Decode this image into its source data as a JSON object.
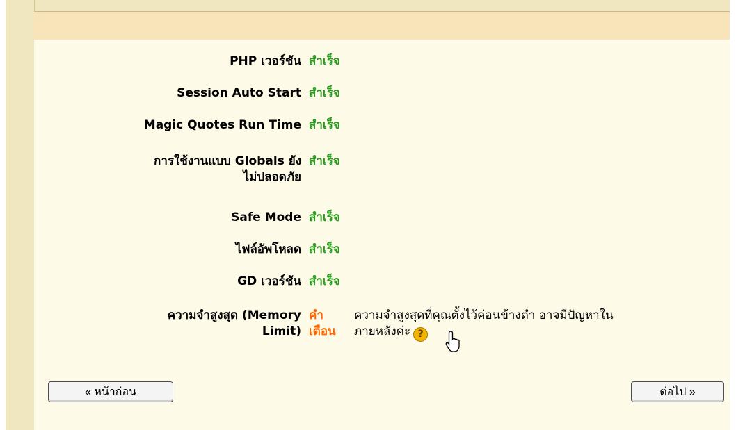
{
  "checks": [
    {
      "label": "PHP เวอร์ชัน",
      "status": "สำเร็จ",
      "kind": "ok"
    },
    {
      "label": "Session Auto Start",
      "status": "สำเร็จ",
      "kind": "ok"
    },
    {
      "label": "Magic Quotes Run Time",
      "status": "สำเร็จ",
      "kind": "ok"
    },
    {
      "label_line1": "การใช้งานแบบ Globals ยัง",
      "label_line2": "ไม่ปลอดภัย",
      "status": "สำเร็จ",
      "kind": "ok"
    },
    {
      "label": "Safe Mode",
      "status": "สำเร็จ",
      "kind": "ok"
    },
    {
      "label": "ไฟล์อัพโหลด",
      "status": "สำเร็จ",
      "kind": "ok"
    },
    {
      "label": "GD เวอร์ชัน",
      "status": "สำเร็จ",
      "kind": "ok"
    },
    {
      "label_line1": "ความจำสูงสุด (Memory",
      "label_line2": "Limit)",
      "status_line1": "คำ",
      "status_line2": "เตือน",
      "kind": "warn",
      "message_line1": "ความจำสูงสุดที่คุณตั้งไว้ค่อนข้างต่ำ อาจมีปัญหาใน",
      "message_line2": "ภายหลังค่ะ"
    }
  ],
  "help_icon": "help-question-icon",
  "cursor_icon": "hand-pointer-icon",
  "nav": {
    "prev_label": "« หน้าก่อน",
    "next_label": "ต่อไป »"
  },
  "colors": {
    "ok": "#2b9b1f",
    "warn": "#ff6600",
    "header_band": "#f8e4b8",
    "content_bg": "#fefae8"
  }
}
